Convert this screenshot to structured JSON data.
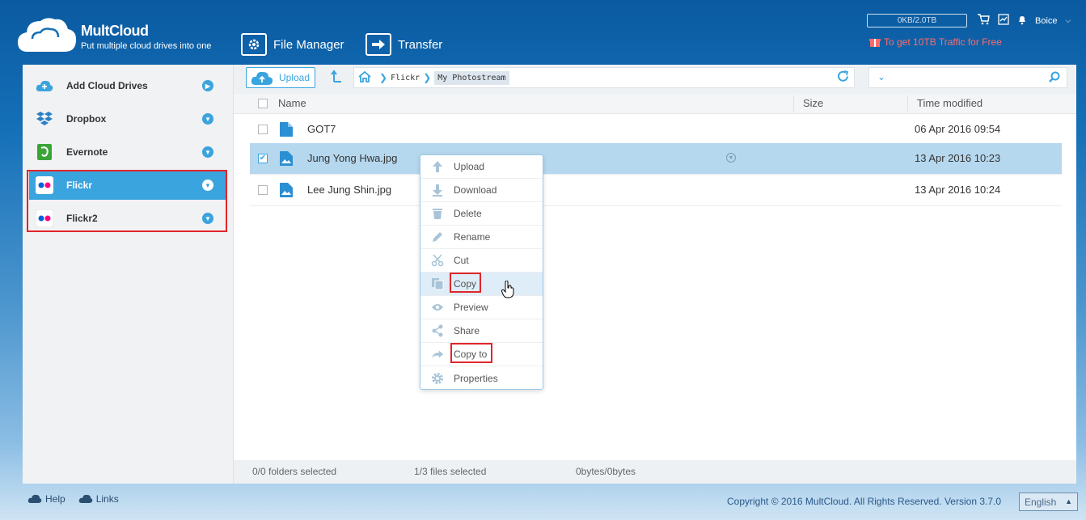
{
  "header": {
    "brand": "MultCloud",
    "tagline": "Put multiple cloud drives into one",
    "nav": [
      {
        "label": "File Manager",
        "icon": "gear-icon"
      },
      {
        "label": "Transfer",
        "icon": "transfer-arrow-icon"
      }
    ],
    "storage_usage": "0KB/2.0TB",
    "user_name": "Boice",
    "promo": "To get 10TB Traffic for Free"
  },
  "sidebar": {
    "items": [
      {
        "label": "Add Cloud Drives",
        "icon": "add-cloud-icon"
      },
      {
        "label": "Dropbox",
        "icon": "dropbox-icon"
      },
      {
        "label": "Evernote",
        "icon": "evernote-icon"
      },
      {
        "label": "Flickr",
        "icon": "flickr-icon",
        "active": true
      },
      {
        "label": "Flickr2",
        "icon": "flickr-icon"
      }
    ]
  },
  "toolbar": {
    "upload_label": "Upload",
    "breadcrumb": [
      "Flickr",
      "My Photostream"
    ]
  },
  "table": {
    "columns": [
      "Name",
      "Size",
      "Time modified"
    ],
    "rows": [
      {
        "name": "GOT7",
        "type": "folder",
        "size": "",
        "modified": "06 Apr 2016 09:54",
        "selected": false
      },
      {
        "name": "Jung Yong Hwa.jpg",
        "type": "image",
        "size": "",
        "modified": "13 Apr 2016 10:23",
        "selected": true
      },
      {
        "name": "Lee Jung Shin.jpg",
        "type": "image",
        "size": "",
        "modified": "13 Apr 2016 10:24",
        "selected": false
      }
    ]
  },
  "context_menu": {
    "items": [
      {
        "label": "Upload",
        "icon": "upload-icon"
      },
      {
        "label": "Download",
        "icon": "download-icon"
      },
      {
        "label": "Delete",
        "icon": "trash-icon"
      },
      {
        "label": "Rename",
        "icon": "pencil-icon"
      },
      {
        "label": "Cut",
        "icon": "scissors-icon"
      },
      {
        "label": "Copy",
        "icon": "copy-icon",
        "hovered": true
      },
      {
        "label": "Preview",
        "icon": "eye-icon"
      },
      {
        "label": "Share",
        "icon": "share-icon"
      },
      {
        "label": "Copy to",
        "icon": "copy-to-icon"
      },
      {
        "label": "Properties",
        "icon": "gear-icon"
      }
    ]
  },
  "status": {
    "folders": "0/0 folders selected",
    "files": "1/3 files selected",
    "bytes": "0bytes/0bytes"
  },
  "footer": {
    "help": "Help",
    "links": "Links",
    "copyright": "Copyright © 2016 MultCloud. All Rights Reserved. Version 3.7.0",
    "language": "English"
  },
  "colors": {
    "accent": "#3aa4de",
    "highlight_box": "#e0262b",
    "selected_row": "#b6d8ee",
    "promo": "#ff6b6b"
  }
}
